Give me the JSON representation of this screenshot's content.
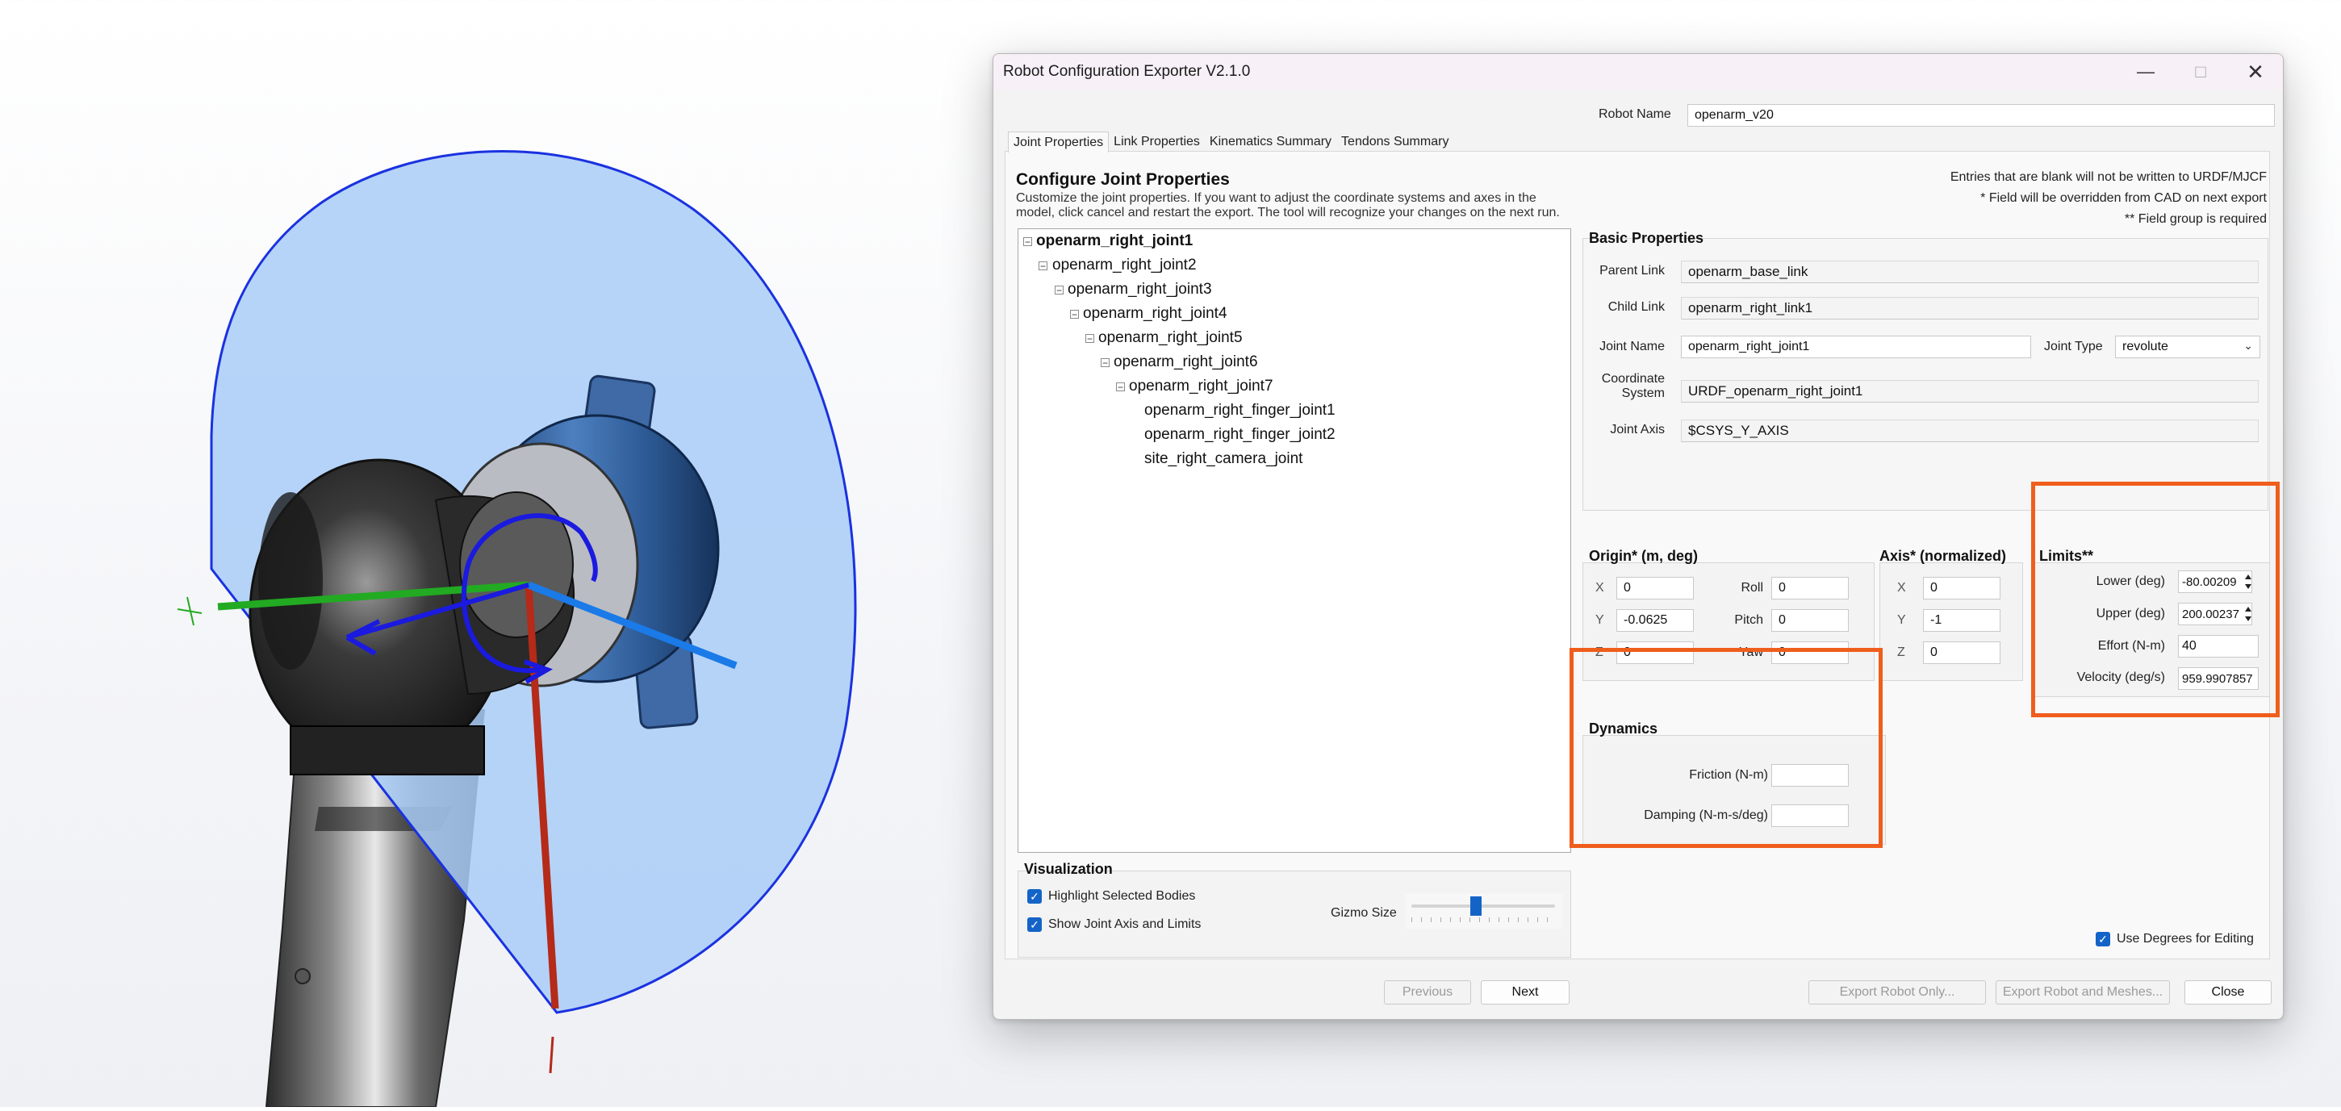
{
  "window": {
    "title": "Robot Configuration Exporter V2.1.0",
    "minimize_icon": "minimize-icon",
    "maximize_icon": "maximize-icon",
    "close_icon": "close-icon"
  },
  "robot_name": {
    "label": "Robot Name",
    "value": "openarm_v20"
  },
  "tabs": [
    {
      "label": "Joint Properties",
      "active": true
    },
    {
      "label": "Link Properties"
    },
    {
      "label": "Kinematics Summary"
    },
    {
      "label": "Tendons Summary"
    }
  ],
  "header": {
    "title": "Configure Joint Properties",
    "description_line1": "Customize the joint properties. If you want to adjust the coordinate systems and axes in the",
    "description_line2": "model, click cancel and restart the export. The tool will recognize your changes on the next run.",
    "note1": "Entries that are blank will not be written to URDF/MJCF",
    "note2": "* Field will be overridden from CAD on next export",
    "note3": "** Field group is required"
  },
  "tree": [
    {
      "label": "openarm_right_joint1",
      "bold": true
    },
    {
      "label": "openarm_right_joint2"
    },
    {
      "label": "openarm_right_joint3"
    },
    {
      "label": "openarm_right_joint4"
    },
    {
      "label": "openarm_right_joint5"
    },
    {
      "label": "openarm_right_joint6"
    },
    {
      "label": "openarm_right_joint7"
    },
    {
      "label": "openarm_right_finger_joint1"
    },
    {
      "label": "openarm_right_finger_joint2"
    },
    {
      "label": "site_right_camera_joint"
    }
  ],
  "basic": {
    "title": "Basic Properties",
    "parent_link_label": "Parent Link",
    "parent_link": "openarm_base_link",
    "child_link_label": "Child Link",
    "child_link": "openarm_right_link1",
    "joint_name_label": "Joint Name",
    "joint_name": "openarm_right_joint1",
    "joint_type_label": "Joint Type",
    "joint_type": "revolute",
    "coord_label_1": "Coordinate",
    "coord_label_2": "System",
    "coord_system": "URDF_openarm_right_joint1",
    "joint_axis_label": "Joint Axis",
    "joint_axis": "$CSYS_Y_AXIS"
  },
  "origin": {
    "title": "Origin* (m, deg)",
    "x_label": "X",
    "x": "0",
    "y_label": "Y",
    "y": "-0.0625",
    "z_label": "Z",
    "z": "0",
    "roll_label": "Roll",
    "roll": "0",
    "pitch_label": "Pitch",
    "pitch": "0",
    "yaw_label": "Yaw",
    "yaw": "0"
  },
  "axis": {
    "title": "Axis* (normalized)",
    "x_label": "X",
    "x": "0",
    "y_label": "Y",
    "y": "-1",
    "z_label": "Z",
    "z": "0"
  },
  "limits": {
    "title": "Limits**",
    "lower_label": "Lower (deg)",
    "lower": "-80.00209",
    "upper_label": "Upper (deg)",
    "upper": "200.00237",
    "effort_label": "Effort (N-m)",
    "effort": "40",
    "velocity_label": "Velocity (deg/s)",
    "velocity": "959.9907857"
  },
  "dynamics": {
    "title": "Dynamics",
    "friction_label": "Friction (N-m)",
    "friction": "",
    "damping_label": "Damping (N-m-s/deg)",
    "damping": ""
  },
  "visualization": {
    "title": "Visualization",
    "highlight_label": "Highlight Selected Bodies",
    "show_axis_label": "Show Joint Axis and Limits",
    "gizmo_label": "Gizmo Size",
    "gizmo_size": 0.45
  },
  "use_degrees_label": "Use Degrees for Editing",
  "buttons": {
    "previous": "Previous",
    "next": "Next",
    "export_robot": "Export Robot Only...",
    "export_meshes": "Export Robot and Meshes...",
    "close": "Close"
  },
  "colors": {
    "accent": "#1464c8",
    "highlight": "#ef5e1c",
    "joint_disc": "#a9ccf7"
  }
}
